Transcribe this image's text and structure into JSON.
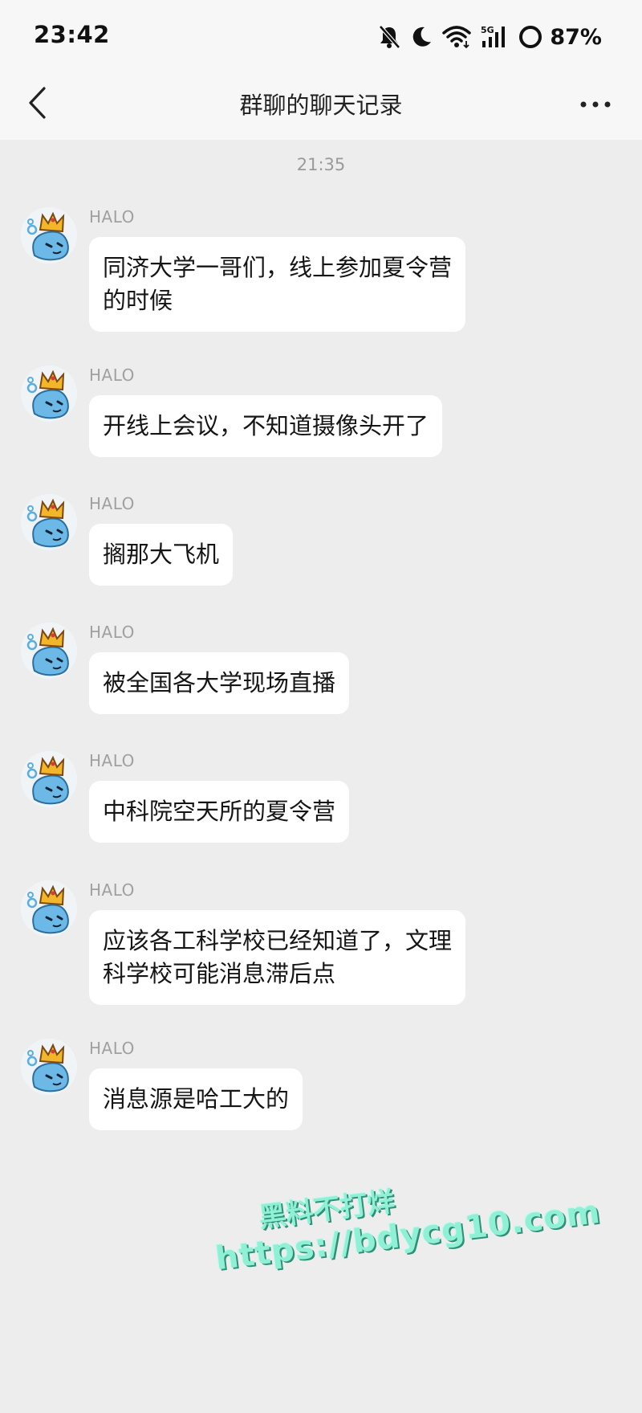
{
  "status_bar": {
    "time": "23:42",
    "network": "5G",
    "battery": "87%",
    "icons": [
      "bell-off-icon",
      "moon-icon",
      "wifi-icon",
      "signal-icon",
      "battery-ring-icon"
    ]
  },
  "nav": {
    "title": "群聊的聊天记录",
    "back_icon": "chevron-left-icon",
    "more_icon": "more-dots-icon"
  },
  "chat": {
    "timestamp": "21:35",
    "messages": [
      {
        "sender": "HALO",
        "lines": [
          "同济大学一哥们，线上参加夏令营",
          "的时候"
        ]
      },
      {
        "sender": "HALO",
        "lines": [
          "开线上会议，不知道摄像头开了"
        ]
      },
      {
        "sender": "HALO",
        "lines": [
          "搁那大飞机"
        ]
      },
      {
        "sender": "HALO",
        "lines": [
          "被全国各大学现场直播"
        ]
      },
      {
        "sender": "HALO",
        "lines": [
          "中科院空天所的夏令营"
        ]
      },
      {
        "sender": "HALO",
        "lines": [
          "应该各工科学校已经知道了，文理",
          "科学校可能消息滞后点"
        ]
      },
      {
        "sender": "HALO",
        "lines": [
          "消息源是哈工大的"
        ]
      }
    ]
  },
  "watermark": {
    "line1": "黑料不打烊",
    "line2": "https://bdycg10.com"
  },
  "colors": {
    "background": "#ededed",
    "header": "#f7f7f7",
    "bubble": "#ffffff",
    "watermark": "#8ff0d6"
  }
}
